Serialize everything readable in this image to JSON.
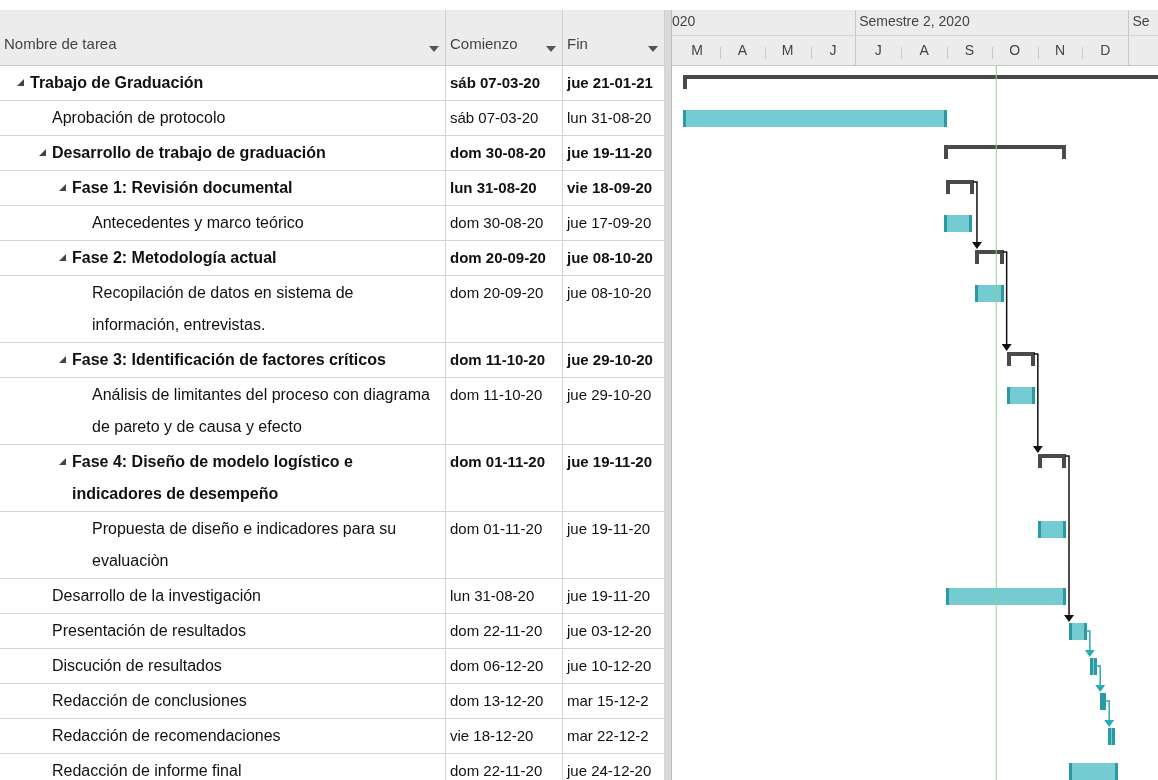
{
  "columns": [
    {
      "label": "Nombre de tarea"
    },
    {
      "label": "Comienzo"
    },
    {
      "label": "Fin"
    }
  ],
  "timescale": [
    {
      "label": "020",
      "months": [
        "M",
        "A",
        "M",
        "J"
      ]
    },
    {
      "label": "Semestre 2, 2020",
      "months": [
        "J",
        "A",
        "S",
        "O",
        "N",
        "D"
      ]
    },
    {
      "label": "Se"
    }
  ],
  "tasks": [
    {
      "name": "Trabajo de Graduación",
      "start": "sáb 07-03-20",
      "end": "jue 21-01-21",
      "kind": "summary",
      "expanded": true,
      "in_chain": false,
      "children": [
        {
          "name": "Aprobación de protocolo",
          "start": "sáb 07-03-20",
          "end": "lun 31-08-20",
          "kind": "task",
          "in_chain": false
        },
        {
          "name": "Desarrollo de trabajo de graduación",
          "start": "dom 30-08-20",
          "end": "jue 19-11-20",
          "kind": "summary",
          "expanded": true,
          "in_chain": false,
          "children": [
            {
              "name": "Fase 1: Revisión documental",
              "start": "lun 31-08-20",
              "end": "vie 18-09-20",
              "kind": "summary",
              "expanded": true,
              "in_chain": true,
              "children": [
                {
                  "name": "Antecedentes y marco teórico",
                  "start": "dom 30-08-20",
                  "end": "jue 17-09-20",
                  "kind": "task",
                  "in_chain": false
                }
              ]
            },
            {
              "name": "Fase 2: Metodología actual",
              "start": "dom 20-09-20",
              "end": "jue 08-10-20",
              "kind": "summary",
              "expanded": true,
              "in_chain": true,
              "children": [
                {
                  "name": "Recopilación de datos en sistema de información, entrevistas.",
                  "start": "dom 20-09-20",
                  "end": "jue 08-10-20",
                  "kind": "task",
                  "in_chain": false
                }
              ]
            },
            {
              "name": "Fase 3: Identificación de factores críticos",
              "start": "dom 11-10-20",
              "end": "jue 29-10-20",
              "kind": "summary",
              "expanded": true,
              "in_chain": true,
              "children": [
                {
                  "name": "Análisis de limitantes del proceso con diagrama de pareto y de causa y efecto",
                  "start": "dom 11-10-20",
                  "end": "jue 29-10-20",
                  "kind": "task",
                  "in_chain": false
                }
              ]
            },
            {
              "name": "Fase 4: Diseño de modelo logístico e indicadores de desempeño",
              "start": "dom 01-11-20",
              "end": "jue 19-11-20",
              "kind": "summary",
              "expanded": true,
              "in_chain": true,
              "children": [
                {
                  "name": "Propuesta de diseño e indicadores para su evaluaciòn",
                  "start": "dom 01-11-20",
                  "end": "jue 19-11-20",
                  "kind": "task",
                  "in_chain": false
                }
              ]
            }
          ]
        },
        {
          "name": "Desarrollo de la investigación",
          "start": "lun 31-08-20",
          "end": "jue 19-11-20",
          "kind": "task",
          "in_chain": false
        },
        {
          "name": "Presentación de resultados",
          "start": "dom 22-11-20",
          "end": "jue 03-12-20",
          "kind": "task",
          "in_chain": true
        },
        {
          "name": "Discución de resultados",
          "start": "dom 06-12-20",
          "end": "jue 10-12-20",
          "kind": "task",
          "in_chain": true
        },
        {
          "name": "Redacción de conclusiones",
          "start": "dom 13-12-20",
          "end": "mar 15-12-2",
          "kind": "task",
          "in_chain": true
        },
        {
          "name": "Redacción de recomendaciones",
          "start": "vie 18-12-20",
          "end": "mar 22-12-2",
          "kind": "task",
          "in_chain": true
        },
        {
          "name": "Redacción de informe final",
          "start": "dom 22-11-20",
          "end": "jue 24-12-20",
          "kind": "task",
          "in_chain": false
        }
      ]
    }
  ]
}
